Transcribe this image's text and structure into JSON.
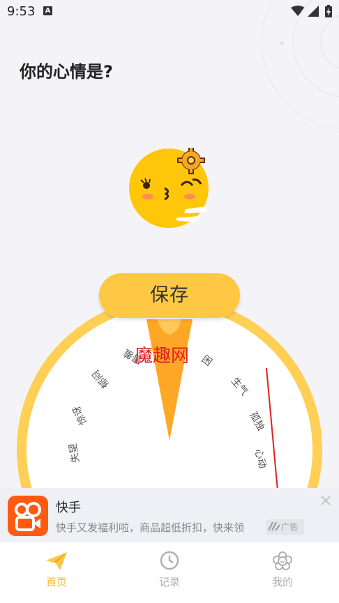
{
  "status_bar": {
    "time": "9:53",
    "notification_letter": "A"
  },
  "page": {
    "title": "你的心情是?"
  },
  "save_button": {
    "label": "保存"
  },
  "mood_wheel": {
    "labels": [
      "困",
      "生气",
      "孤独",
      "心动",
      "失望",
      "惊讶",
      "郁闷",
      "害羞"
    ]
  },
  "watermark": {
    "text": "魔趣网"
  },
  "ad": {
    "app_name": "快手",
    "description": "快手又发福利啦，商品超低折扣，快来领",
    "tag": "广告"
  },
  "bottom_nav": {
    "items": [
      {
        "label": "首页",
        "icon": "paper-plane-icon",
        "active": true
      },
      {
        "label": "记录",
        "icon": "clock-icon",
        "active": false
      },
      {
        "label": "我的",
        "icon": "flower-icon",
        "active": false
      }
    ]
  },
  "colors": {
    "accent": "#FFC844",
    "accent_active_text": "#F5B82E",
    "inactive": "#B0B0B0",
    "wheel_rim": "#FFCF56",
    "pointer": "#FFA726",
    "annotation_red": "#E02020"
  }
}
